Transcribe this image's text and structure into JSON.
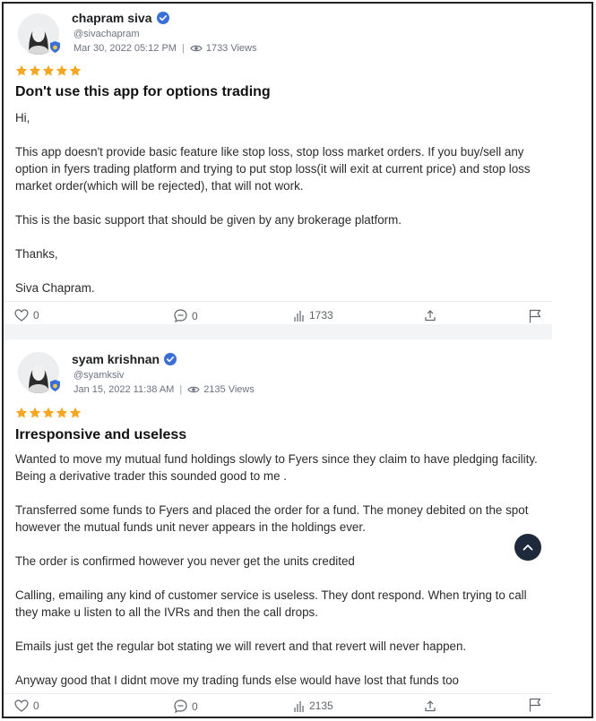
{
  "reviews": [
    {
      "name": "chapram siva",
      "handle": "@sivachapram",
      "date": "Mar 30, 2022 05:12 PM",
      "views": "1733 Views",
      "rating": 5,
      "title": "Don't use this app for options trading",
      "paragraphs": [
        "Hi,",
        "This app doesn't provide basic feature like stop loss, stop loss market orders. If you buy/sell any option in fyers trading platform and trying to put stop loss(it will exit at current price) and stop loss market order(which will be rejected), that will not work.",
        "This is the basic support that should be given by any brokerage platform.",
        "Thanks,",
        "Siva Chapram."
      ],
      "likes": "0",
      "comments": "0",
      "stats": "1733"
    },
    {
      "name": "syam krishnan",
      "handle": "@syamksiv",
      "date": "Jan 15, 2022 11:38 AM",
      "views": "2135 Views",
      "rating": 5,
      "title": "Irresponsive and useless",
      "paragraphs": [
        "Wanted to move my mutual fund holdings slowly to Fyers since they claim to have pledging facility. Being a derivative trader this sounded good to me .",
        "Transferred some funds to Fyers and placed the order for a fund. The money debited on the spot however the mutual funds unit never appears in the holdings ever.",
        "The order is confirmed however you never get the units credited",
        "Calling, emailing any kind of customer service is useless. They dont respond. When trying to call they make u listen to all the IVRs and then the call drops.",
        "Emails just get the regular bot stating we will revert and that revert will never happen.",
        "Anyway good that I didnt move my trading funds else would have lost that funds too"
      ],
      "likes": "0",
      "comments": "0",
      "stats": "2135"
    }
  ],
  "colors": {
    "star": "#f5a623",
    "verified": "#3b6fd8",
    "scroll_button": "#1e2a3c"
  },
  "icons": [
    "verified-badge-icon",
    "eye-icon",
    "star-icon",
    "heart-icon",
    "comment-icon",
    "bar-chart-icon",
    "share-icon",
    "flag-icon",
    "chevron-up-icon"
  ]
}
